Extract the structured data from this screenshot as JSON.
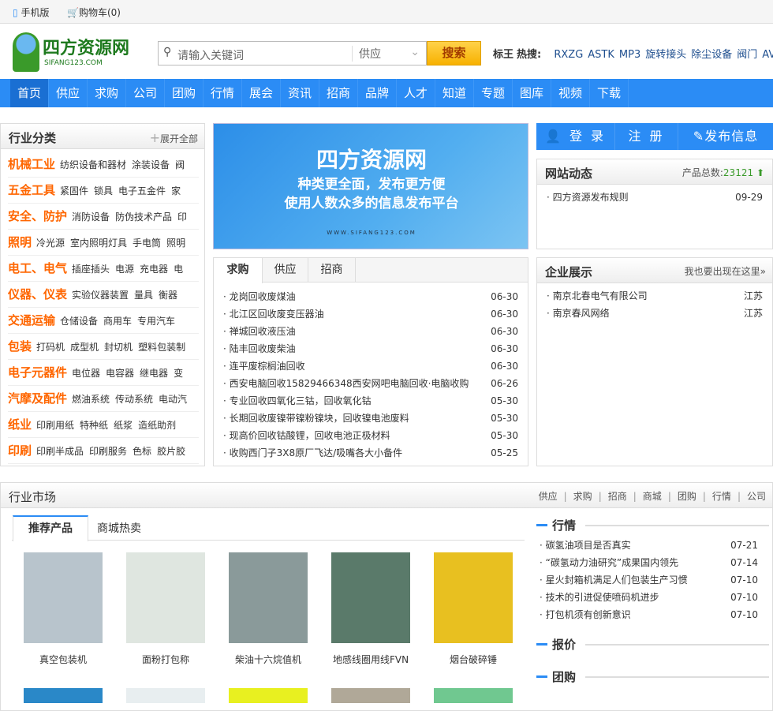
{
  "topbar": {
    "mobile": "手机版",
    "cart": "购物车(0)"
  },
  "logo": {
    "name": "四方资源网",
    "domain": "SIFANG123.COM"
  },
  "search": {
    "placeholder": "请输入关键词",
    "type": "供应",
    "button": "搜索"
  },
  "hot": {
    "label1": "标王",
    "label2": "热搜:",
    "words": [
      "RXZG",
      "ASTK",
      "MP3",
      "旋转接头",
      "除尘设备",
      "阀门",
      "AV"
    ]
  },
  "nav": [
    "首页",
    "供应",
    "求购",
    "公司",
    "团购",
    "行情",
    "展会",
    "资讯",
    "招商",
    "品牌",
    "人才",
    "知道",
    "专题",
    "图库",
    "视频",
    "下载"
  ],
  "categories": {
    "title": "行业分类",
    "expand": "展开全部",
    "rows": [
      {
        "name": "机械工业",
        "items": [
          "纺织设备和器材",
          "涂装设备",
          "阀"
        ]
      },
      {
        "name": "五金工具",
        "items": [
          "紧固件",
          "锁具",
          "电子五金件",
          "家"
        ]
      },
      {
        "name": "安全、防护",
        "items": [
          "消防设备",
          "防伪技术产品",
          "印"
        ]
      },
      {
        "name": "照明",
        "items": [
          "冷光源",
          "室内照明灯具",
          "手电筒",
          "照明"
        ]
      },
      {
        "name": "电工、电气",
        "items": [
          "插座插头",
          "电源",
          "充电器",
          "电"
        ]
      },
      {
        "name": "仪器、仪表",
        "items": [
          "实验仪器装置",
          "量具",
          "衡器"
        ]
      },
      {
        "name": "交通运输",
        "items": [
          "仓储设备",
          "商用车",
          "专用汽车"
        ]
      },
      {
        "name": "包装",
        "items": [
          "打码机",
          "成型机",
          "封切机",
          "塑料包装制"
        ]
      },
      {
        "name": "电子元器件",
        "items": [
          "电位器",
          "电容器",
          "继电器",
          "变"
        ]
      },
      {
        "name": "汽摩及配件",
        "items": [
          "燃油系统",
          "传动系统",
          "电动汽"
        ]
      },
      {
        "name": "纸业",
        "items": [
          "印刷用纸",
          "特种纸",
          "纸浆",
          "造纸助剂"
        ]
      },
      {
        "name": "印刷",
        "items": [
          "印刷半成品",
          "印刷服务",
          "色标",
          "胶片胶"
        ]
      }
    ]
  },
  "banner": {
    "title": "四方资源网",
    "line1": "种类更全面，发布更方便",
    "line2": "使用人数众多的信息发布平台",
    "url": "WWW.SIFANG123.COM"
  },
  "trade": {
    "tabs": [
      "求购",
      "供应",
      "招商"
    ],
    "items": [
      {
        "t": "龙岗回收废煤油",
        "d": "06-30"
      },
      {
        "t": "北江区回收废变压器油",
        "d": "06-30"
      },
      {
        "t": "禅城回收液压油",
        "d": "06-30"
      },
      {
        "t": "陆丰回收废柴油",
        "d": "06-30"
      },
      {
        "t": "连平废棕榈油回收",
        "d": "06-30"
      },
      {
        "t": "西安电脑回收15829466348西安网吧电脑回收·电脑收购",
        "d": "06-26"
      },
      {
        "t": "专业回收四氧化三钴，回收氧化钴",
        "d": "05-30"
      },
      {
        "t": "长期回收废镍带镍粉镍块，回收镍电池废料",
        "d": "05-30"
      },
      {
        "t": "现高价回收钴酸锂，回收电池正极材料",
        "d": "05-30"
      },
      {
        "t": "收购西门子3X8原厂飞达/吸嘴各大小备件",
        "d": "05-25"
      }
    ]
  },
  "user": {
    "login": "登 录",
    "register": "注 册",
    "publish": "发布信息"
  },
  "news": {
    "title": "网站动态",
    "count_label": "产品总数:",
    "count": "23121",
    "items": [
      {
        "t": "四方资源发布规则",
        "d": "09-29"
      }
    ]
  },
  "companies": {
    "title": "企业展示",
    "more": "我也要出现在这里»",
    "items": [
      {
        "t": "南京北春电气有限公司",
        "d": "江苏"
      },
      {
        "t": "南京春风网络",
        "d": "江苏"
      }
    ]
  },
  "market": {
    "title": "行业市场",
    "links": [
      "供应",
      "求购",
      "招商",
      "商城",
      "团购",
      "行情",
      "公司"
    ],
    "tabs": [
      "推荐产品",
      "商城热卖"
    ],
    "products": [
      {
        "n": "真空包装机",
        "c": "#b8c4cc"
      },
      {
        "n": "面粉打包称",
        "c": "#dfe6e0"
      },
      {
        "n": "柴油十六烷值机",
        "c": "#8a9a9a"
      },
      {
        "n": "地感线圈用线FVN",
        "c": "#5a7a6a"
      },
      {
        "n": "烟台破碎锤",
        "c": "#e8c020"
      }
    ],
    "row2": [
      "#2a88c8",
      "#e8eef0",
      "#e8f020",
      "#b0a898",
      "#70c890"
    ],
    "hq_title": "行情",
    "hq": [
      {
        "t": "碳氢油项目是否真实",
        "d": "07-21"
      },
      {
        "t": "“碳氢动力油研究”成果国内领先",
        "d": "07-14"
      },
      {
        "t": "星火封箱机满足人们包装生产习惯",
        "d": "07-10"
      },
      {
        "t": "技术的引进促使喷码机进步",
        "d": "07-10"
      },
      {
        "t": "打包机须有创新意识",
        "d": "07-10"
      }
    ],
    "price_title": "报价",
    "group_title": "团购"
  }
}
